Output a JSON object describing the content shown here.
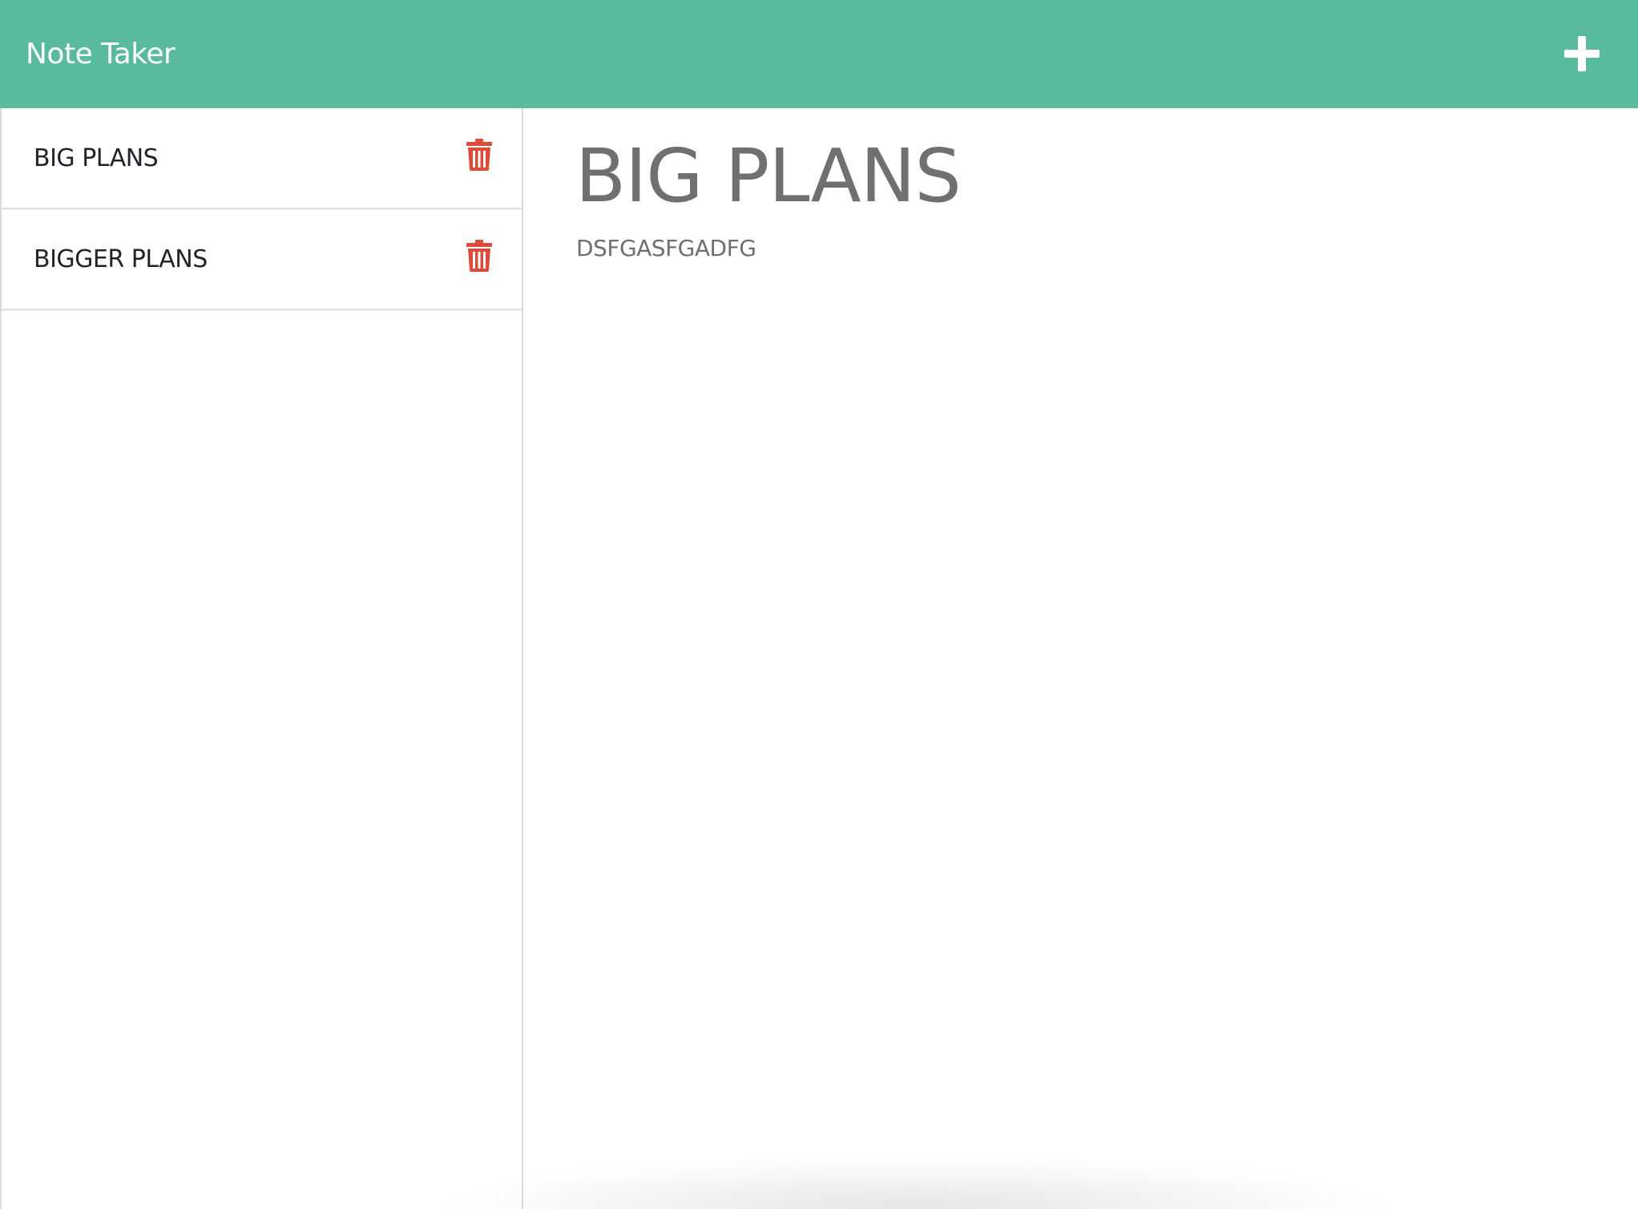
{
  "navbar": {
    "brand": "Note Taker",
    "add_icon": "plus-icon",
    "color": "#5aba9e"
  },
  "notes": [
    {
      "title": "BIG PLANS",
      "delete_icon": "trash-icon"
    },
    {
      "title": "BIGGER PLANS",
      "delete_icon": "trash-icon"
    }
  ],
  "active_note": {
    "title": "BIG PLANS",
    "text": "DSFGASFGADFG"
  },
  "colors": {
    "accent": "#5aba9e",
    "delete": "#dd4b39"
  }
}
